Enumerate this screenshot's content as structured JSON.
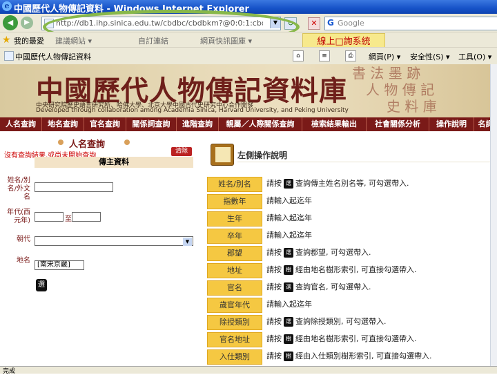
{
  "window": {
    "title": "中國歷代人物傳記資料 - Windows Internet Explorer",
    "address": "http://db1.ihp.sinica.edu.tw/cbdbc/cbdbkm?@0:0:1:cbdb@@0.1",
    "search_placeholder": "Google",
    "favorites_label": "我的最愛",
    "favorites_others": [
      "建議網站 ▾",
      "自訂連結",
      "網頁快訊圖庫 ▾"
    ],
    "tab_title": "中國歷代人物傳記資料",
    "toolbar": [
      "網頁(P) ▾",
      "安全性(S) ▾",
      "工具(O) ▾"
    ]
  },
  "callout": "線上□詢系統",
  "banner": {
    "title": "中國歷代人物傳記資料庫",
    "subtitle_zh": "中央研究院歷史語言研究所、哈佛大學、北京大學中國古代史研究中心合作開發",
    "subtitle_en": "Developed through collaboration among Academia Sinica, Harvard University, and Peking University"
  },
  "nav": [
    "人名查詢",
    "地名查詢",
    "官名查詢",
    "關係詞查詢",
    "進階查詢",
    "親屬／人際關係查詢",
    "檢索結果輸出",
    "社會關係分析",
    "操作說明",
    "名詞"
  ],
  "left": {
    "title": "人名查詢",
    "notice": "沒有查詢結果,或尚未開始查詢",
    "clear_button": "清除",
    "section": "傳主資料",
    "labels": {
      "name": "姓名/別名/外文名",
      "year": "年代(西元年)",
      "dynasty": "朝代",
      "place": "地名"
    },
    "year_sep": "至",
    "place_value": "[南宋京畿]"
  },
  "right": {
    "title": "左側操作說明",
    "rows": [
      {
        "label": "姓名/別名",
        "desc": "查詢傳主姓名別名等, 可勾選帶入.",
        "icon": true
      },
      {
        "label": "指數年",
        "desc": "請輸入起迄年",
        "icon": false
      },
      {
        "label": "生年",
        "desc": "請輸入起迄年",
        "icon": false
      },
      {
        "label": "卒年",
        "desc": "請輸入起迄年",
        "icon": false
      },
      {
        "label": "郡望",
        "desc": "查詢郡望, 可勾選帶入.",
        "icon": true
      },
      {
        "label": "地址",
        "desc": "經由地名樹形索引, 可直接勾選帶入.",
        "icon": true
      },
      {
        "label": "官名",
        "desc": "查詢官名, 可勾選帶入.",
        "icon": true
      },
      {
        "label": "歲官年代",
        "desc": "請輸入起迄年",
        "icon": false
      },
      {
        "label": "除授類別",
        "desc": "查詢除授類別, 可勾選帶入.",
        "icon": true
      },
      {
        "label": "官名地址",
        "desc": "經由地名樹形索引, 可直接勾選帶入.",
        "icon": true
      },
      {
        "label": "入仕類別",
        "desc": "經由入仕類別樹形索引, 可直接勾選帶入.",
        "icon": true
      }
    ],
    "prefix": "請按",
    "prefix_plain": "請輸入"
  },
  "status": "完成",
  "colors": {
    "nav": "#7a1a18",
    "label_bg": "#f5c842",
    "callout_bg": "#f7e98c",
    "ellipse": "#88b84a"
  }
}
